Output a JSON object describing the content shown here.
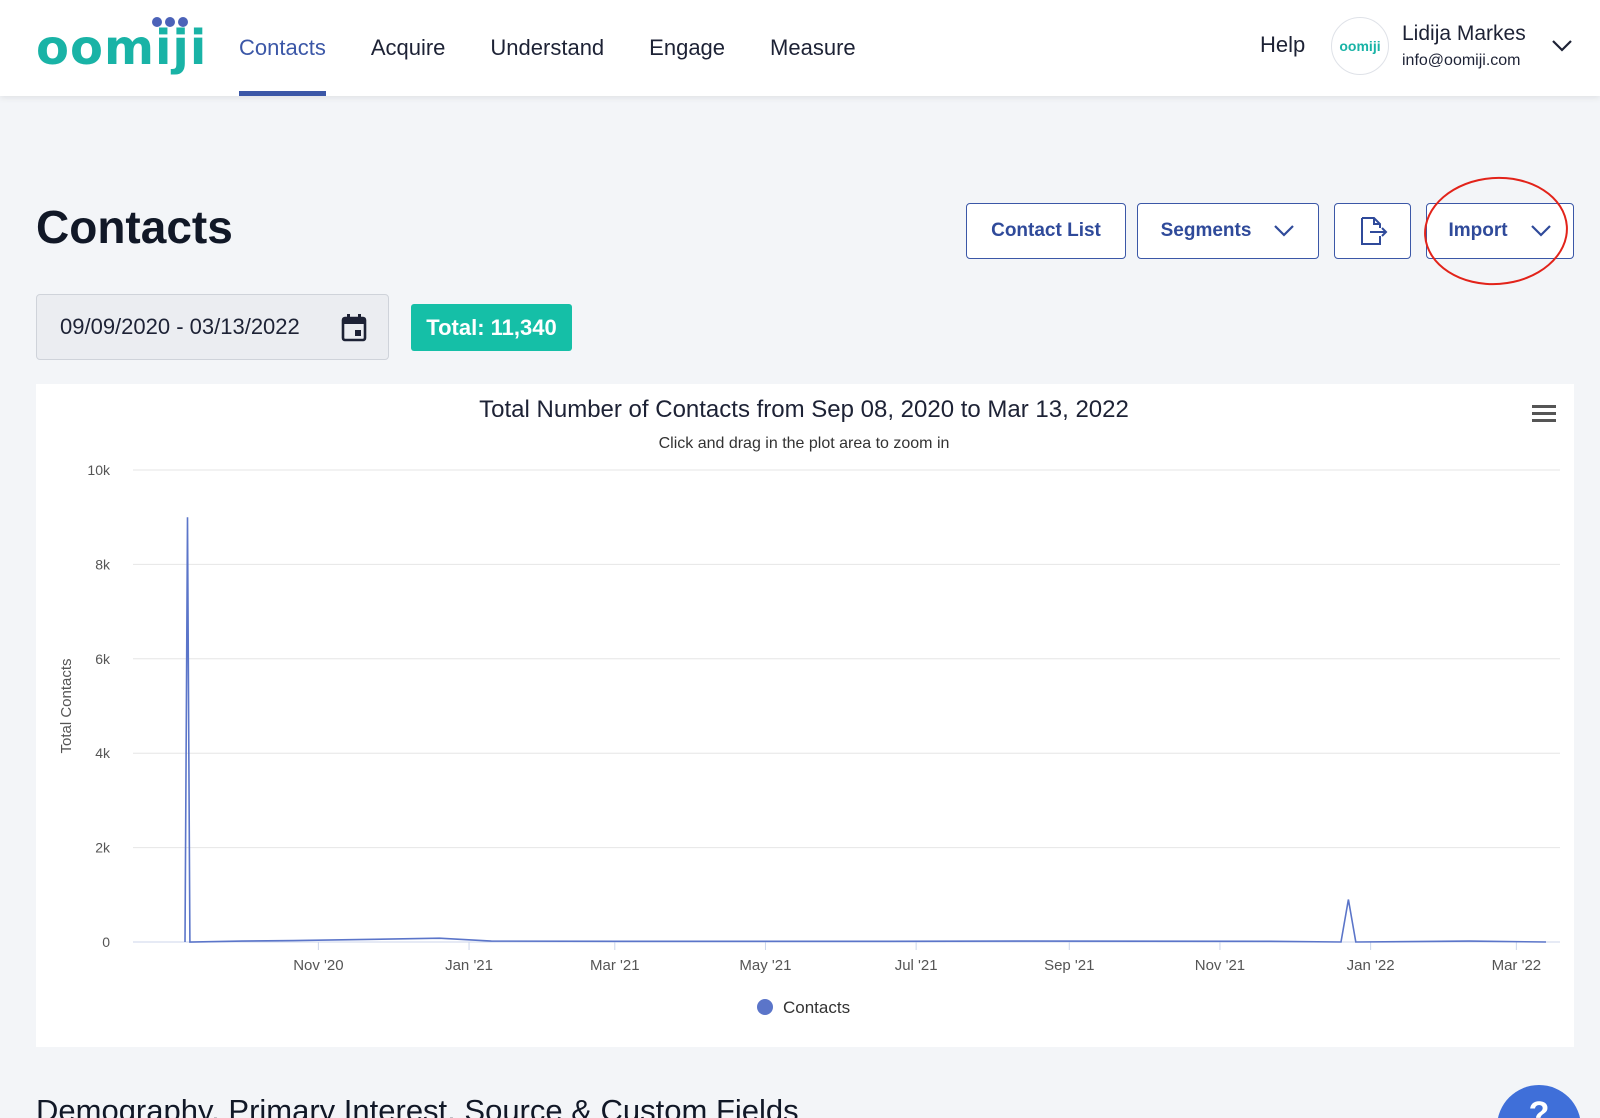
{
  "header": {
    "logo_text": "oomiji",
    "nav": [
      "Contacts",
      "Acquire",
      "Understand",
      "Engage",
      "Measure"
    ],
    "active_nav": "Contacts",
    "help_label": "Help",
    "avatar_text": "oomiji",
    "user_name": "Lidija Markes",
    "user_email": "info@oomiji.com"
  },
  "page": {
    "title": "Contacts",
    "buttons": {
      "contact_list": "Contact List",
      "segments": "Segments",
      "import": "Import"
    },
    "date_range": "09/09/2020 - 03/13/2022",
    "total_badge": "Total: 11,340",
    "section_title": "Demography, Primary Interest, Source & Custom Fields",
    "help_fab": "?"
  },
  "colors": {
    "brand_teal": "#19b3a6",
    "brand_blue": "#3b57a7",
    "badge_green": "#15bfa7",
    "series": "#5b75c9",
    "annotation_red": "#e2231a"
  },
  "icons": {
    "calendar": "calendar-icon",
    "export": "export-file-icon",
    "menu": "hamburger-menu-icon",
    "chevron": "chevron-down-icon"
  },
  "chart_data": {
    "type": "line",
    "title": "Total Number of Contacts from Sep 08, 2020 to Mar 13, 2022",
    "subtitle": "Click and drag in the plot area to zoom in",
    "ylabel": "Total Contacts",
    "xlabel": "",
    "ylim": [
      0,
      10000
    ],
    "y_ticks": [
      "0",
      "2k",
      "4k",
      "6k",
      "8k",
      "10k"
    ],
    "y_tick_values": [
      0,
      2000,
      4000,
      6000,
      8000,
      10000
    ],
    "x_tick_labels": [
      "Nov '20",
      "Jan '21",
      "Mar '21",
      "May '21",
      "Jul '21",
      "Sep '21",
      "Nov '21",
      "Jan '22",
      "Mar '22"
    ],
    "x_tick_dates": [
      "2020-11-01",
      "2021-01-01",
      "2021-03-01",
      "2021-05-01",
      "2021-07-01",
      "2021-09-01",
      "2021-11-01",
      "2022-01-01",
      "2022-03-01"
    ],
    "x_range": [
      "2020-09-08",
      "2022-03-13"
    ],
    "grid": true,
    "legend_position": "bottom-center",
    "series": [
      {
        "name": "Contacts",
        "points": [
          [
            "2020-09-08",
            0
          ],
          [
            "2020-09-09",
            9000
          ],
          [
            "2020-09-10",
            0
          ],
          [
            "2020-10-01",
            20
          ],
          [
            "2020-10-22",
            30
          ],
          [
            "2020-12-20",
            80
          ],
          [
            "2021-01-10",
            20
          ],
          [
            "2021-03-05",
            15
          ],
          [
            "2021-06-10",
            15
          ],
          [
            "2021-08-12",
            20
          ],
          [
            "2021-11-20",
            15
          ],
          [
            "2021-12-20",
            0
          ],
          [
            "2021-12-23",
            900
          ],
          [
            "2021-12-26",
            0
          ],
          [
            "2022-02-10",
            20
          ],
          [
            "2022-03-13",
            0
          ]
        ]
      }
    ]
  }
}
